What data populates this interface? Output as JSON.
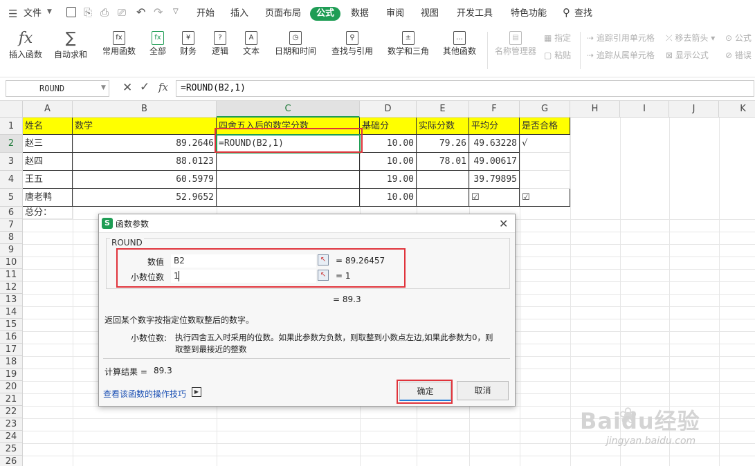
{
  "menubar": {
    "file": "文件",
    "tabs": [
      "开始",
      "插入",
      "页面布局",
      "公式",
      "数据",
      "审阅",
      "视图",
      "开发工具",
      "特色功能"
    ],
    "active_tab": "公式",
    "search": "查找"
  },
  "ribbon": {
    "buttons": [
      "插入函数",
      "自动求和",
      "常用函数",
      "全部",
      "财务",
      "逻辑",
      "文本",
      "日期和时间",
      "查找与引用",
      "数学和三角",
      "其他函数"
    ],
    "name_manager": "名称管理器",
    "define": "指定",
    "paste": "粘贴",
    "trace_precedents": "追踪引用单元格",
    "trace_dependents": "追踪从属单元格",
    "remove_arrows": "移去箭头",
    "show_formulas": "显示公式",
    "formula_short": "公式",
    "error_short": "错误"
  },
  "formula_bar": {
    "name_box": "ROUND",
    "formula": "=ROUND(B2,1)",
    "fx": "fx"
  },
  "columns": [
    "A",
    "B",
    "C",
    "D",
    "E",
    "F",
    "G",
    "H",
    "I",
    "J",
    "K"
  ],
  "rows": [
    "1",
    "2",
    "3",
    "4",
    "5",
    "6",
    "7",
    "8",
    "9",
    "10",
    "11",
    "12",
    "13",
    "14",
    "15",
    "16",
    "17",
    "18",
    "19",
    "20",
    "21",
    "22",
    "23",
    "24",
    "25",
    "26"
  ],
  "sheet": {
    "headers": [
      "姓名",
      "数学",
      "四舍五入后的数学分数",
      "基础分",
      "实际分数",
      "平均分",
      "是否合格"
    ],
    "data": [
      [
        "赵三",
        "89.2646",
        "=ROUND(B2,1)",
        "10.00",
        "79.26",
        "49.63228",
        "√"
      ],
      [
        "赵四",
        "88.0123",
        "",
        "10.00",
        "78.01",
        "49.00617",
        ""
      ],
      [
        "王五",
        "60.5979",
        "",
        "19.00",
        "",
        "39.79895",
        ""
      ],
      [
        "唐老鸭",
        "52.9652",
        "",
        "10.00",
        "",
        "☑",
        "☑"
      ]
    ],
    "total_label": "总分："
  },
  "dialog": {
    "title": "函数参数",
    "function_name": "ROUND",
    "arg1_label": "数值",
    "arg1_value": "B2",
    "arg1_result": "= 89.26457",
    "arg2_label": "小数位数",
    "arg2_value": "1",
    "arg2_result": "= 1",
    "preview_result": "= 89.3",
    "description": "返回某个数字按指定位数取整后的数字。",
    "param_name": "小数位数:",
    "param_desc_1": "执行四舍五入时采用的位数。如果此参数为负数，则取整到小数点左边,如果此参数为0，则",
    "param_desc_2": "取整到最接近的整数",
    "calc_label": "计算结果 =",
    "calc_value": "89.3",
    "help_link": "查看该函数的操作技巧",
    "ok": "确定",
    "cancel": "取消"
  },
  "watermark": {
    "brand": "Baidu经验",
    "url": "jingyan.baidu.com"
  }
}
